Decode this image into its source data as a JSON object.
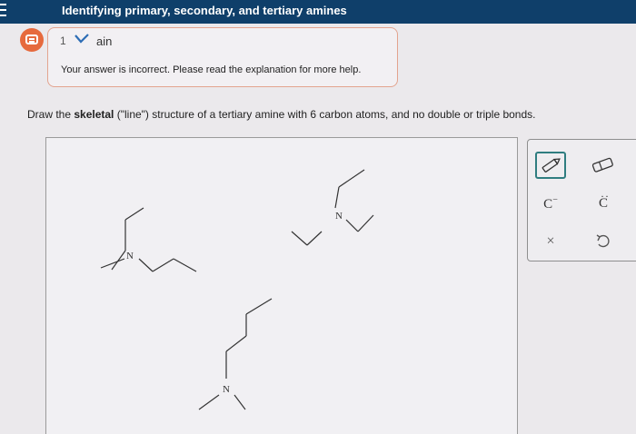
{
  "header": {
    "title": "Identifying primary, secondary, and tertiary amines"
  },
  "feedback": {
    "attempt_number": "1",
    "explain_fragment": "ain",
    "message": "Your answer is incorrect. Please read the explanation for more help."
  },
  "question": {
    "prefix": "Draw the ",
    "bold": "skeletal",
    "suffix": " (\"line\") structure of a tertiary amine with 6 carbon atoms, and no double or triple bonds."
  },
  "canvas": {
    "atom_labels": [
      "N",
      "N",
      "N"
    ]
  },
  "toolbar": {
    "tools": [
      {
        "name": "pencil-tool",
        "icon": "pencil-icon"
      },
      {
        "name": "eraser-tool",
        "icon": "eraser-icon"
      },
      {
        "name": "carbanion-tool",
        "label": "C",
        "sup": "−"
      },
      {
        "name": "lone-pair-tool",
        "label": "C",
        "mark": "dots"
      },
      {
        "name": "clear-tool",
        "label": "×"
      },
      {
        "name": "undo-tool",
        "icon": "undo-icon"
      }
    ]
  },
  "colors": {
    "header_bg": "#0f3f6a",
    "feedback_border": "#e3a48f",
    "feedback_icon": "#e66a3d",
    "selected_tool": "#2f7d80"
  }
}
